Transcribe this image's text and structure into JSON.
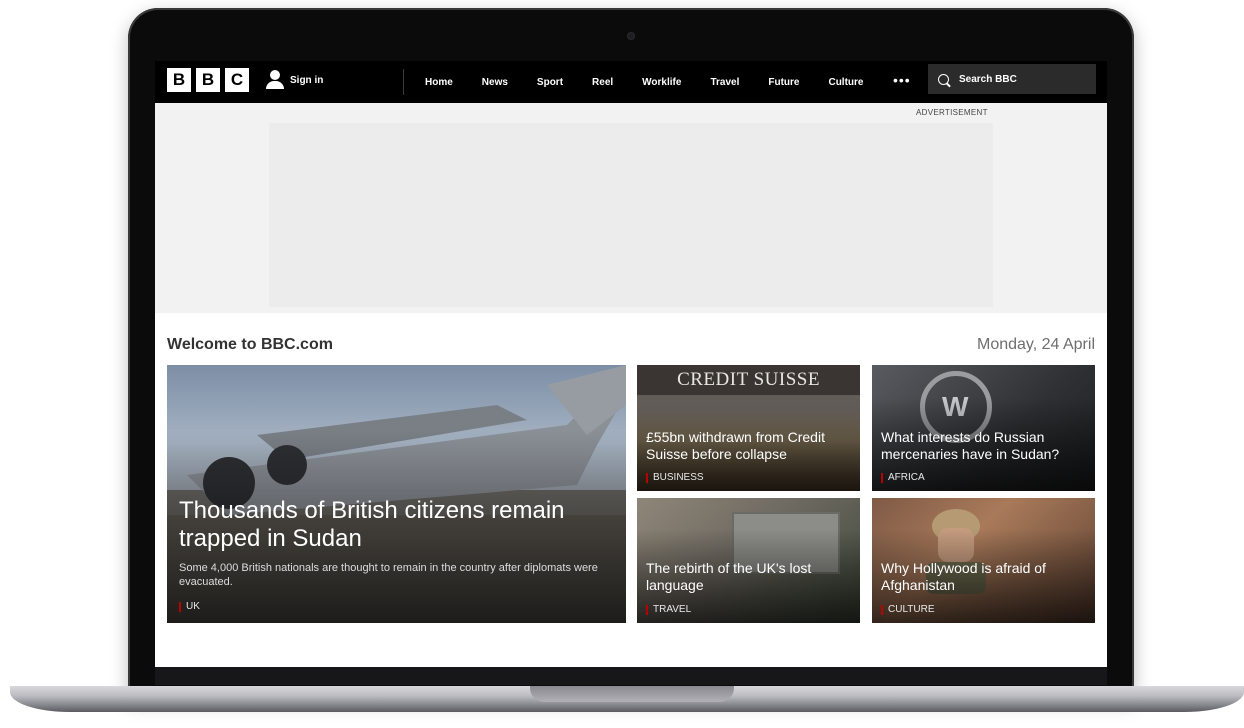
{
  "logo": [
    "B",
    "B",
    "C"
  ],
  "header": {
    "sign_in_label": "Sign in",
    "nav_items": [
      "Home",
      "News",
      "Sport",
      "Reel",
      "Worklife",
      "Travel",
      "Future",
      "Culture"
    ],
    "more_label": "•••",
    "search_placeholder": "Search BBC"
  },
  "ad": {
    "label": "ADVERTISEMENT"
  },
  "welcome": {
    "title": "Welcome to BBC.com",
    "date": "Monday, 24 April"
  },
  "main_story": {
    "headline": "Thousands of British citizens remain trapped in Sudan",
    "summary": "Some 4,000 British nationals are thought to remain in the country after diplomats were evacuated.",
    "tag": "UK"
  },
  "stories": [
    {
      "headline": "£55bn withdrawn from Credit Suisse before collapse",
      "tag": "BUSINESS",
      "image_text": "CREDIT SUISSE"
    },
    {
      "headline": "What interests do Russian mercenaries have in Sudan?",
      "tag": "AFRICA"
    },
    {
      "headline": "The rebirth of the UK's lost language",
      "tag": "TRAVEL"
    },
    {
      "headline": "Why Hollywood is afraid of Afghanistan",
      "tag": "CULTURE"
    }
  ],
  "colors": {
    "bbc_red": "#b80000",
    "nav_bg": "#000000",
    "ad_bg": "#f2f2f2"
  }
}
